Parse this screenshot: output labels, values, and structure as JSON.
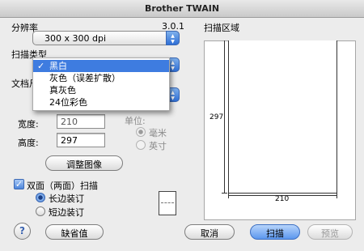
{
  "window": {
    "title": "Brother TWAIN"
  },
  "resolution": {
    "label": "分辨率",
    "version": "3.0.1",
    "value": "300 x 300 dpi"
  },
  "scan_type": {
    "label": "扫描类型",
    "options": [
      {
        "label": "黑白",
        "checked": true
      },
      {
        "label": "灰色（误差扩散）",
        "checked": false
      },
      {
        "label": "真灰色",
        "checked": false
      },
      {
        "label": "24位彩色",
        "checked": false
      }
    ],
    "check_mark": "✓"
  },
  "document_size": {
    "label_visible": "文档尺"
  },
  "width": {
    "label": "宽度:",
    "value": "210"
  },
  "height": {
    "label": "高度:",
    "value": "297"
  },
  "unit": {
    "label": "单位:",
    "options": [
      {
        "label": "毫米",
        "selected": true
      },
      {
        "label": "英寸",
        "selected": false
      }
    ]
  },
  "adjust_button": "调整图像",
  "duplex": {
    "label": "双面（两面）扫描",
    "checked": true,
    "options": [
      {
        "label": "长边装订",
        "selected": true
      },
      {
        "label": "短边装订",
        "selected": false
      }
    ]
  },
  "scan_area": {
    "label": "扫描区域",
    "width_value": "210",
    "height_value": "297"
  },
  "buttons": {
    "help": "?",
    "defaults": "缺省值",
    "cancel": "取消",
    "scan": "扫描",
    "preview": "预览"
  }
}
